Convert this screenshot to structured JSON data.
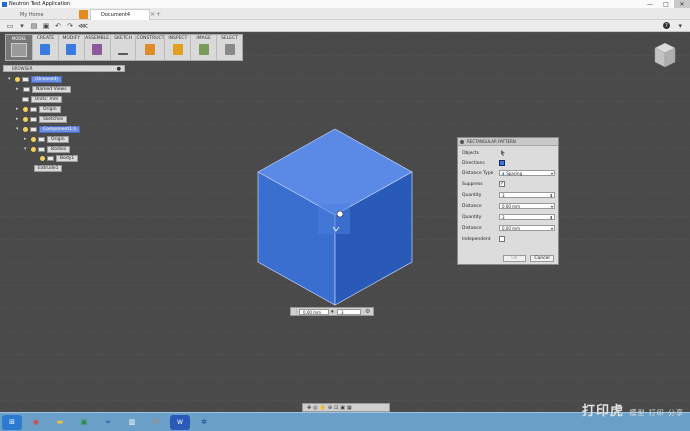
{
  "window": {
    "title": "Neutron Test Application",
    "controls": [
      "—",
      "□",
      "✕"
    ]
  },
  "tabs": {
    "home": "My Home",
    "document": "Document4",
    "close": "×",
    "new": "+"
  },
  "ribbon": {
    "mode": "MODEL",
    "groups": [
      {
        "label": "CREATE",
        "color": "#3b7be0"
      },
      {
        "label": "MODIFY",
        "color": "#3b7be0"
      },
      {
        "label": "ASSEMBLE",
        "color": "#8a5a9a"
      },
      {
        "label": "SKETCH",
        "color": "#5a5a5a"
      },
      {
        "label": "CONSTRUCT",
        "color": "#e08a2a"
      },
      {
        "label": "INSPECT",
        "color": "#e0a020"
      },
      {
        "label": "IMAGE",
        "color": "#7a9a5a"
      },
      {
        "label": "SELECT",
        "color": "#888888"
      }
    ]
  },
  "browser": {
    "header": "BROWSER",
    "items": [
      {
        "label": "(Unsaved)",
        "selected": true
      },
      {
        "label": "Named Views",
        "selected": false
      },
      {
        "label": "Units: mm",
        "selected": false
      },
      {
        "label": "Origin",
        "selected": false
      },
      {
        "label": "Sketches",
        "selected": false
      },
      {
        "label": "Component1:1",
        "selected": true
      },
      {
        "label": "Origin",
        "selected": false
      },
      {
        "label": "Bodies",
        "selected": false
      },
      {
        "label": "Body1",
        "selected": false
      },
      {
        "label": "Extrude1",
        "selected": false
      }
    ]
  },
  "dialog": {
    "title": "RECTANGULAR PATTERN",
    "objects_label": "Objects",
    "directions_label": "Directions",
    "distance_type_label": "Distance Type",
    "distance_type_value": "Spacing",
    "suppress_label": "Suppress",
    "quantity1_label": "Quantity",
    "quantity1_value": "3",
    "distance1_label": "Distance",
    "distance1_value": "0.00 mm",
    "quantity2_label": "Quantity",
    "quantity2_value": "3",
    "distance2_label": "Distance",
    "distance2_value": "0.00 mm",
    "independent_label": "Independent",
    "ok_label": "OK",
    "cancel_label": "Cancel"
  },
  "distance_bar": {
    "distance": "0.00 mm",
    "quantity": "3"
  },
  "watermark": {
    "text": "打印虎",
    "sub": "模型 打印 分享"
  },
  "colors": {
    "canvas": "#4a4a4a",
    "cube_front": "#3a6fd0",
    "cube_top": "#5b8ae6",
    "cube_side": "#2a5ab8",
    "selection": "#6f8fe0"
  }
}
